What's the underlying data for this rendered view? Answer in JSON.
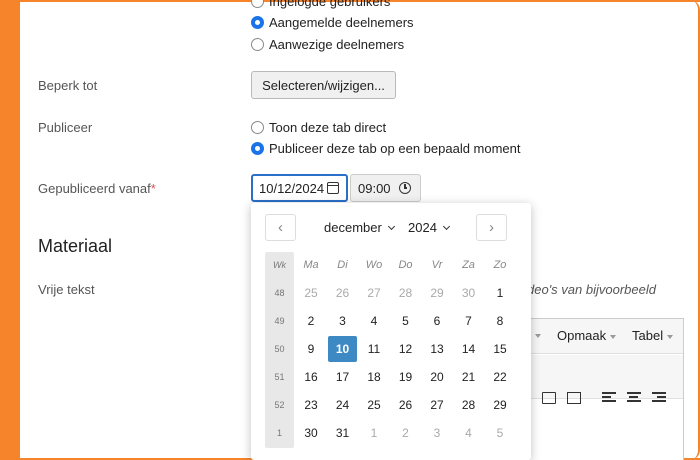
{
  "visibility_options": [
    {
      "label": "Ingelogde gebruikers",
      "checked": false
    },
    {
      "label": "Aangemelde deelnemers",
      "checked": true
    },
    {
      "label": "Aanwezige deelnemers",
      "checked": false
    }
  ],
  "restrict": {
    "label": "Beperk tot",
    "button": "Selecteren/wijzigen..."
  },
  "publish": {
    "label": "Publiceer",
    "options": [
      {
        "label": "Toon deze tab direct",
        "checked": false
      },
      {
        "label": "Publiceer deze tab op een bepaald moment",
        "checked": true
      }
    ]
  },
  "published_from": {
    "label": "Gepubliceerd vanaf",
    "required_mark": "*",
    "date": "10/12/2024",
    "time": "09:00"
  },
  "section": {
    "title": "Materiaal"
  },
  "free_text": {
    "label": "Vrije tekst",
    "hint": "deo's van bijvoorbeeld"
  },
  "editor": {
    "menus": [
      "Opmaak",
      "Tabel"
    ]
  },
  "datepicker": {
    "month": "december",
    "year": "2024",
    "week_header": "Wk",
    "weekdays": [
      "Ma",
      "Di",
      "Wo",
      "Do",
      "Vr",
      "Za",
      "Zo"
    ],
    "weeks": [
      {
        "wk": "48",
        "days": [
          {
            "d": "25",
            "muted": true
          },
          {
            "d": "26",
            "muted": true
          },
          {
            "d": "27",
            "muted": true
          },
          {
            "d": "28",
            "muted": true
          },
          {
            "d": "29",
            "muted": true
          },
          {
            "d": "30",
            "muted": true
          },
          {
            "d": "1"
          }
        ]
      },
      {
        "wk": "49",
        "days": [
          {
            "d": "2"
          },
          {
            "d": "3"
          },
          {
            "d": "4"
          },
          {
            "d": "5"
          },
          {
            "d": "6"
          },
          {
            "d": "7"
          },
          {
            "d": "8"
          }
        ]
      },
      {
        "wk": "50",
        "days": [
          {
            "d": "9"
          },
          {
            "d": "10",
            "selected": true
          },
          {
            "d": "11"
          },
          {
            "d": "12"
          },
          {
            "d": "13"
          },
          {
            "d": "14"
          },
          {
            "d": "15"
          }
        ]
      },
      {
        "wk": "51",
        "days": [
          {
            "d": "16"
          },
          {
            "d": "17"
          },
          {
            "d": "18"
          },
          {
            "d": "19"
          },
          {
            "d": "20"
          },
          {
            "d": "21"
          },
          {
            "d": "22"
          }
        ]
      },
      {
        "wk": "52",
        "days": [
          {
            "d": "23"
          },
          {
            "d": "24"
          },
          {
            "d": "25"
          },
          {
            "d": "26"
          },
          {
            "d": "27"
          },
          {
            "d": "28"
          },
          {
            "d": "29"
          }
        ]
      },
      {
        "wk": "1",
        "days": [
          {
            "d": "30"
          },
          {
            "d": "31"
          },
          {
            "d": "1",
            "muted": true
          },
          {
            "d": "2",
            "muted": true
          },
          {
            "d": "3",
            "muted": true
          },
          {
            "d": "4",
            "muted": true
          },
          {
            "d": "5",
            "muted": true
          }
        ]
      }
    ]
  },
  "colors": {
    "accent_frame": "#f5842b",
    "selected_day": "#3d89c4",
    "radio_checked": "#1a73e8"
  }
}
